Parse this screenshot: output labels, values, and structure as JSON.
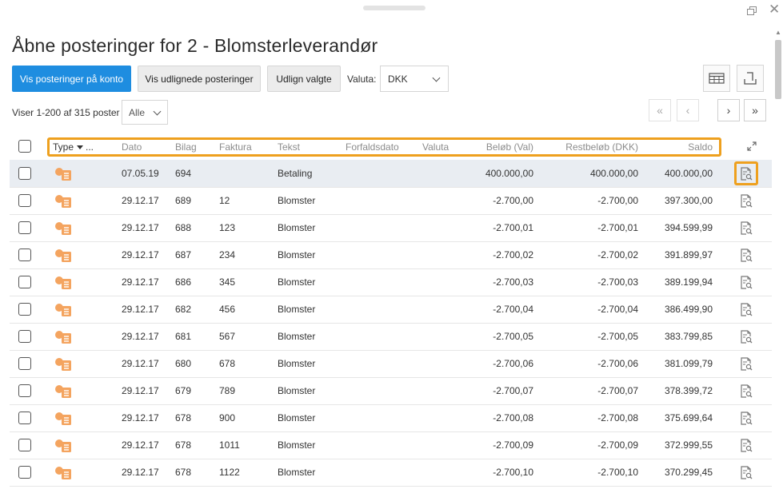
{
  "window": {
    "title": "Åbne posteringer for 2 - Blomsterleverandør"
  },
  "toolbar": {
    "show_entries_on_account": "Vis posteringer på konto",
    "show_unreconciled": "Vis udlignede posteringer",
    "reconcile_selected": "Udlign valgte",
    "currency_label": "Valuta:",
    "currency_value": "DKK"
  },
  "listing": {
    "count_text": "Viser 1-200 af 315 poster",
    "filter_value": "Alle"
  },
  "pager": {
    "first": "«",
    "prev": "‹",
    "next": "›",
    "last": "»"
  },
  "table": {
    "headers": {
      "type": "Type",
      "type_more": "...",
      "date": "Dato",
      "voucher": "Bilag",
      "invoice": "Faktura",
      "text": "Tekst",
      "due_date": "Forfaldsdato",
      "currency": "Valuta",
      "amount_val": "Beløb (Val)",
      "remaining_dkk": "Restbeløb (DKK)",
      "balance": "Saldo"
    },
    "rows": [
      {
        "date": "07.05.19",
        "voucher": "694",
        "invoice": "",
        "text": "Betaling",
        "due_date": "",
        "currency": "",
        "amount": "400.000,00",
        "remaining": "400.000,00",
        "balance": "400.000,00"
      },
      {
        "date": "29.12.17",
        "voucher": "689",
        "invoice": "12",
        "text": "Blomster",
        "due_date": "",
        "currency": "",
        "amount": "-2.700,00",
        "remaining": "-2.700,00",
        "balance": "397.300,00"
      },
      {
        "date": "29.12.17",
        "voucher": "688",
        "invoice": "123",
        "text": "Blomster",
        "due_date": "",
        "currency": "",
        "amount": "-2.700,01",
        "remaining": "-2.700,01",
        "balance": "394.599,99"
      },
      {
        "date": "29.12.17",
        "voucher": "687",
        "invoice": "234",
        "text": "Blomster",
        "due_date": "",
        "currency": "",
        "amount": "-2.700,02",
        "remaining": "-2.700,02",
        "balance": "391.899,97"
      },
      {
        "date": "29.12.17",
        "voucher": "686",
        "invoice": "345",
        "text": "Blomster",
        "due_date": "",
        "currency": "",
        "amount": "-2.700,03",
        "remaining": "-2.700,03",
        "balance": "389.199,94"
      },
      {
        "date": "29.12.17",
        "voucher": "682",
        "invoice": "456",
        "text": "Blomster",
        "due_date": "",
        "currency": "",
        "amount": "-2.700,04",
        "remaining": "-2.700,04",
        "balance": "386.499,90"
      },
      {
        "date": "29.12.17",
        "voucher": "681",
        "invoice": "567",
        "text": "Blomster",
        "due_date": "",
        "currency": "",
        "amount": "-2.700,05",
        "remaining": "-2.700,05",
        "balance": "383.799,85"
      },
      {
        "date": "29.12.17",
        "voucher": "680",
        "invoice": "678",
        "text": "Blomster",
        "due_date": "",
        "currency": "",
        "amount": "-2.700,06",
        "remaining": "-2.700,06",
        "balance": "381.099,79"
      },
      {
        "date": "29.12.17",
        "voucher": "679",
        "invoice": "789",
        "text": "Blomster",
        "due_date": "",
        "currency": "",
        "amount": "-2.700,07",
        "remaining": "-2.700,07",
        "balance": "378.399,72"
      },
      {
        "date": "29.12.17",
        "voucher": "678",
        "invoice": "900",
        "text": "Blomster",
        "due_date": "",
        "currency": "",
        "amount": "-2.700,08",
        "remaining": "-2.700,08",
        "balance": "375.699,64"
      },
      {
        "date": "29.12.17",
        "voucher": "678",
        "invoice": "1011",
        "text": "Blomster",
        "due_date": "",
        "currency": "",
        "amount": "-2.700,09",
        "remaining": "-2.700,09",
        "balance": "372.999,55"
      },
      {
        "date": "29.12.17",
        "voucher": "678",
        "invoice": "1122",
        "text": "Blomster",
        "due_date": "",
        "currency": "",
        "amount": "-2.700,10",
        "remaining": "-2.700,10",
        "balance": "370.299,45"
      }
    ]
  },
  "icons": {
    "type": "invoice-type-icon",
    "row_action": "document-search-icon",
    "columns": "table-columns-icon",
    "export": "export-icon",
    "expand": "expand-icon"
  },
  "colors": {
    "primary": "#1e8de0",
    "highlight": "#eea01e",
    "type_icon": "#f4a45f"
  }
}
